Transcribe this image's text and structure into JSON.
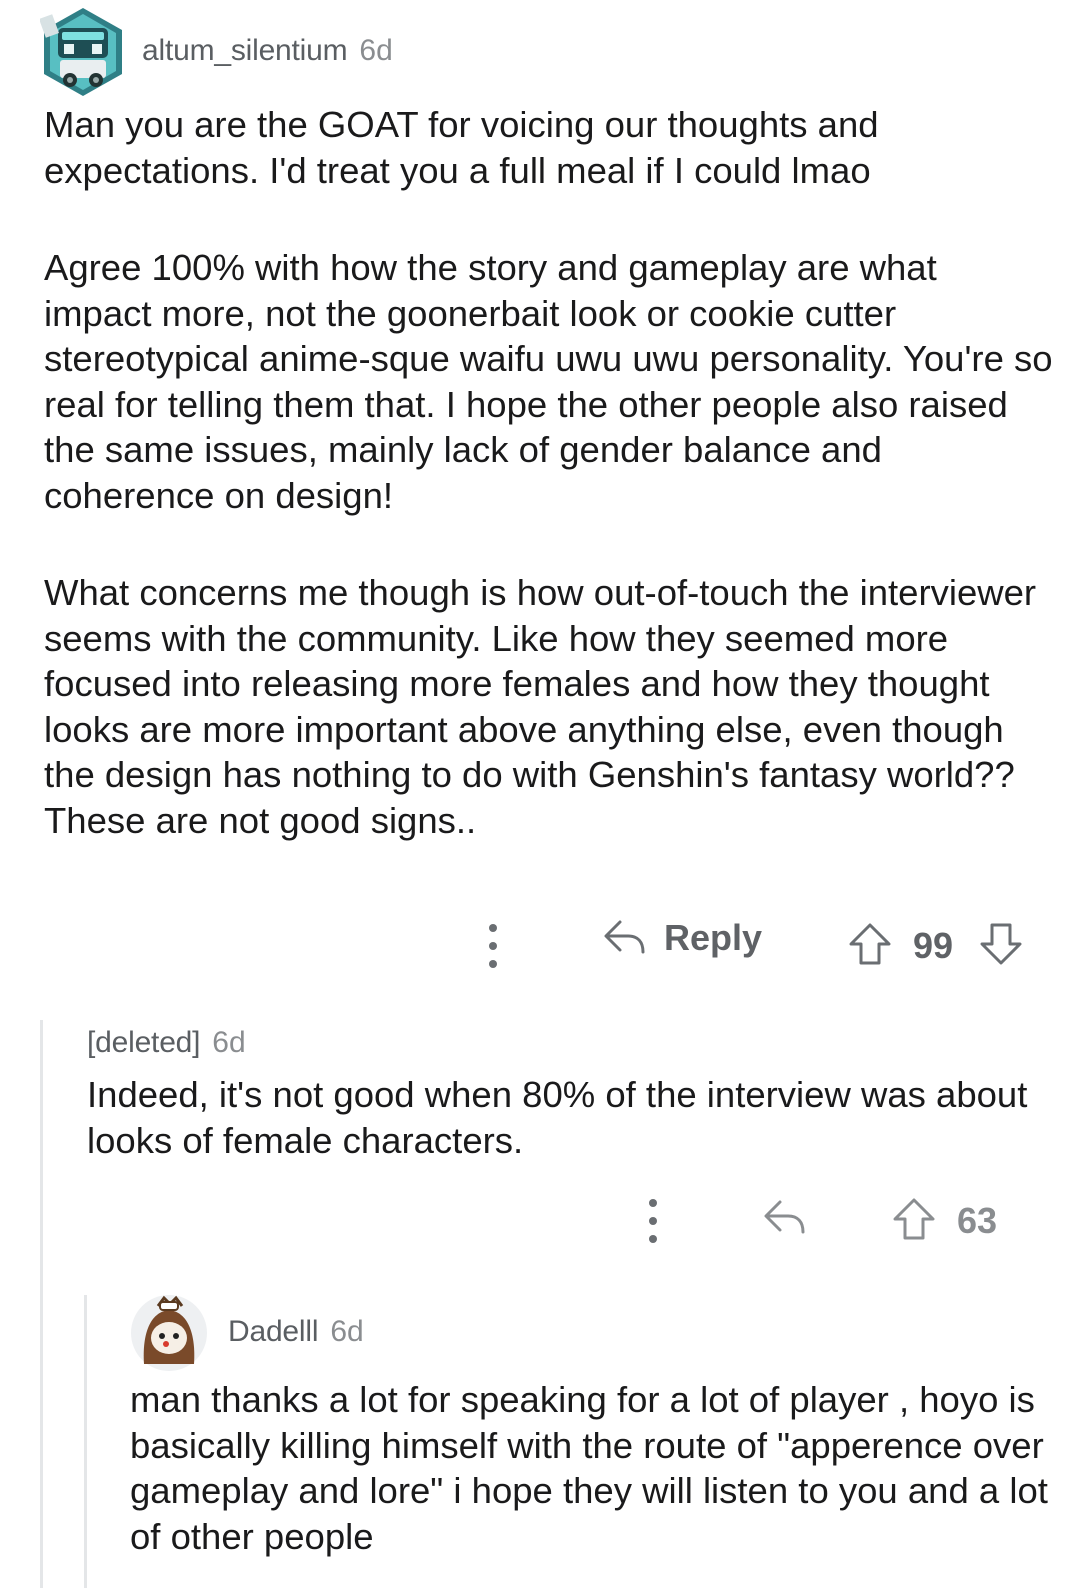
{
  "comments": [
    {
      "author": "altum_silentium",
      "age": "6d",
      "avatar_icon": "robot-avatar-icon",
      "paragraphs": [
        "Man you are the GOAT for voicing our thoughts and expectations. I'd treat you a full meal if I could lmao",
        "Agree 100% with how the story and gameplay are what impact more, not the goonerbait look or cookie cutter stereotypical anime-sque waifu uwu uwu personality. You're so real for telling them that. I hope the other people also raised the same issues, mainly lack of gender balance and coherence on design!",
        "What concerns me though is how out-of-touch the interviewer seems with the community. Like how they seemed more focused into releasing more females and how they thought looks are more important above anything else, even though the design has nothing to do with Genshin's fantasy world?? These are not good signs.."
      ],
      "actions": {
        "reply_label": "Reply",
        "score": "99"
      }
    },
    {
      "author": "[deleted]",
      "age": "6d",
      "paragraphs": [
        "Indeed, it's not good when 80% of the interview was about looks of female characters."
      ],
      "actions": {
        "score": "63"
      }
    },
    {
      "author": "Dadelll",
      "age": "6d",
      "avatar_icon": "hooded-character-avatar-icon",
      "paragraphs": [
        "man thanks a lot for speaking for a lot of player , hoyo is basically killing himself with the route of \"apperence over gameplay and lore\" i hope they will listen to you and a lot of other people"
      ]
    }
  ],
  "colors": {
    "text": "#1a1a1b",
    "meta": "#5a5e62",
    "action": "#5f6266",
    "thread_line": "#e4e6e8"
  }
}
